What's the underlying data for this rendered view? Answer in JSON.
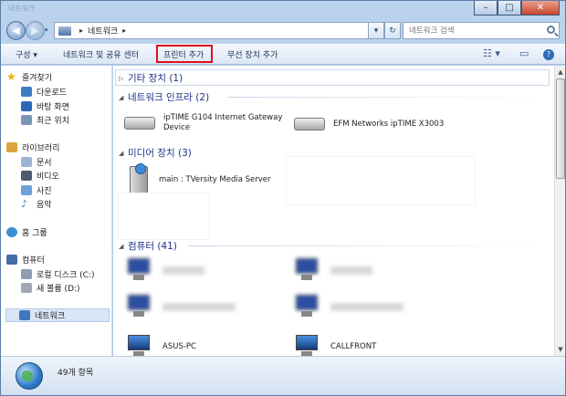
{
  "window": {
    "title": "네트워크",
    "btn_min": "–",
    "btn_max": "□",
    "btn_close": "✕"
  },
  "nav": {
    "back_glyph": "◀",
    "forward_glyph": "▶",
    "dropdown_glyph": "▾",
    "breadcrumb": [
      "네트워크"
    ],
    "crumb_sep": "▸",
    "refresh_glyph": "↻",
    "addr_dropdown_glyph": "▾",
    "search_placeholder": "네트워크 검색"
  },
  "command_bar": {
    "organize": "구성 ▾",
    "network_center": "네트워크 및 공유 센터",
    "add_printer": "프린터 추가",
    "add_wireless": "무선 장치 추가",
    "view_icon": "view-options-icon",
    "view_glyph": "☷ ▾",
    "preview_glyph": "▭",
    "help_glyph": "?"
  },
  "sidebar": {
    "items": [
      {
        "label": "즐겨찾기",
        "icon": "star-icon",
        "color": "#f0b400"
      },
      {
        "label": "다운로드",
        "icon": "downloads-folder-icon",
        "color": "#3f7cc6"
      },
      {
        "label": "바탕 화면",
        "icon": "desktop-icon",
        "color": "#2e66b7"
      },
      {
        "label": "최근 위치",
        "icon": "recent-places-icon",
        "color": "#7a94b8"
      },
      {
        "label": "라이브러리",
        "icon": "library-icon",
        "color": "#d9a63b"
      },
      {
        "label": "문서",
        "icon": "documents-icon",
        "color": "#9cb3d3"
      },
      {
        "label": "비디오",
        "icon": "videos-icon",
        "color": "#4e5b6f"
      },
      {
        "label": "사진",
        "icon": "pictures-icon",
        "color": "#6fa1d8"
      },
      {
        "label": "음악",
        "icon": "music-icon",
        "color": "#4a7fc8"
      },
      {
        "label": "홈 그룹",
        "icon": "homegroup-icon",
        "color": "#3c8fcf"
      },
      {
        "label": "컴퓨터",
        "icon": "computer-icon",
        "color": "#446ca8"
      },
      {
        "label": "로컬 디스크 (C:)",
        "icon": "local-disk-icon",
        "color": "#8c9db0"
      },
      {
        "label": "새 볼륨 (D:)",
        "icon": "volume-icon",
        "color": "#a0a9b4"
      },
      {
        "label": "네트워크",
        "icon": "network-icon",
        "color": "#3e78bf"
      }
    ]
  },
  "content": {
    "groups": [
      {
        "title": "기타 장치 (1)",
        "collapsed_glyph": "▷"
      },
      {
        "title": "네트워크 인프라 (2)",
        "expanded_glyph": "◢"
      },
      {
        "title": "미디어 장치 (3)",
        "expanded_glyph": "◢"
      },
      {
        "title": "컴퓨터 (41)",
        "expanded_glyph": "◢"
      }
    ],
    "infrastructure": [
      {
        "label_line1": "ipTIME G104 Internet Gateway",
        "label_line2": "Device",
        "icon": "router-icon"
      },
      {
        "label_line1": "EFM Networks ipTIME X3003",
        "label_line2": "",
        "icon": "router-icon"
      }
    ],
    "media": [
      {
        "label": "main : TVersity Media Server",
        "icon": "media-server-icon"
      }
    ],
    "computers": [
      {
        "label": "ASUS-PC",
        "icon": "computer-icon"
      },
      {
        "label": "CALLFRONT",
        "icon": "computer-icon"
      }
    ]
  },
  "scrollbar": {
    "up_glyph": "▲",
    "down_glyph": "▼"
  },
  "status": {
    "count": "49개 항목",
    "icon": "network-globe-icon"
  }
}
